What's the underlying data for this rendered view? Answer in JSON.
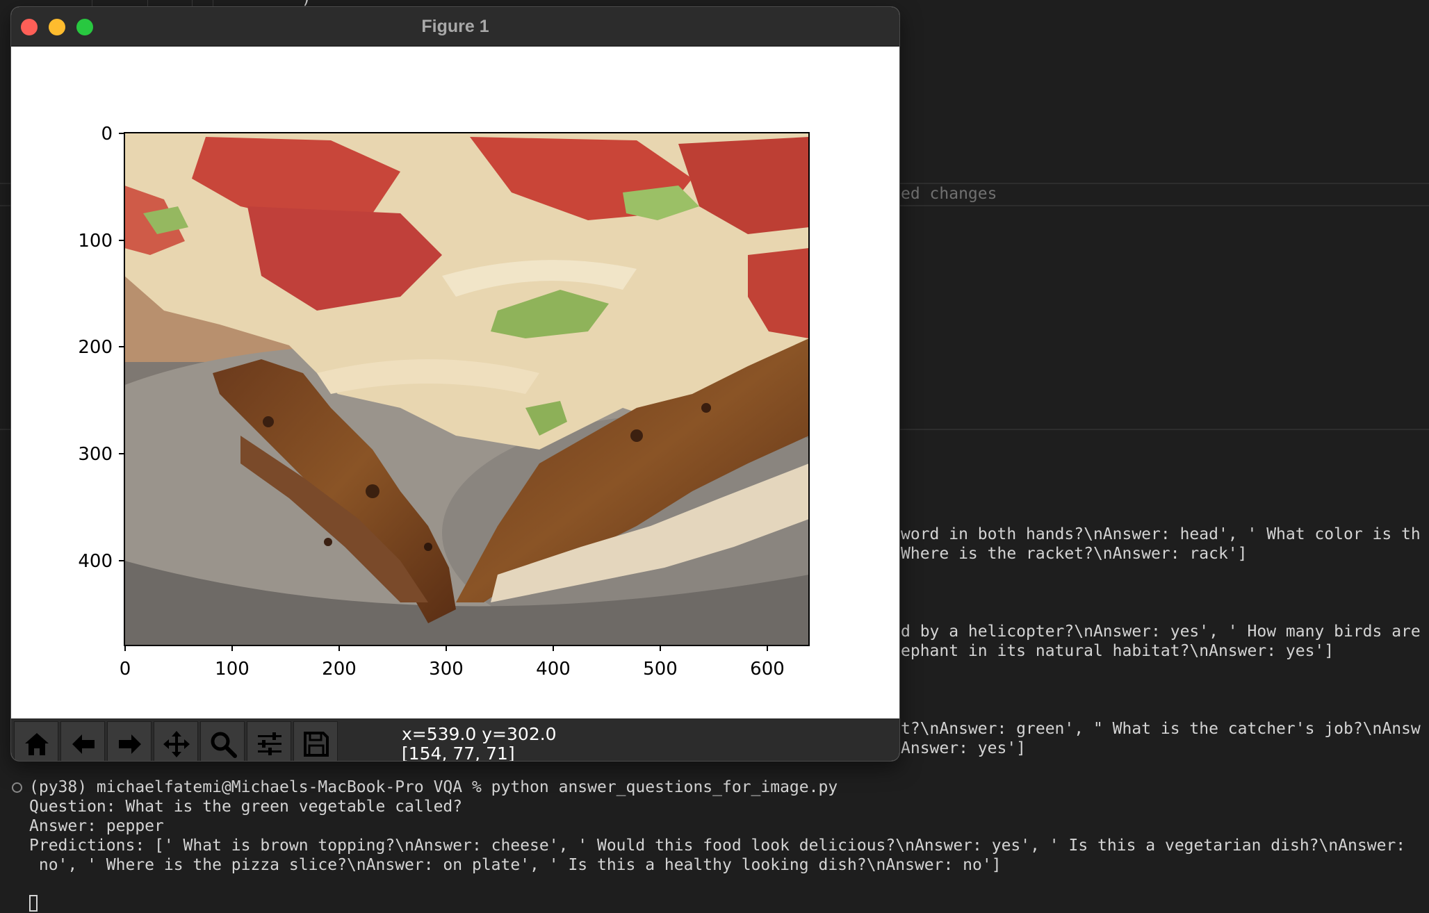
{
  "window": {
    "title": "Figure 1"
  },
  "plot": {
    "y_ticks": [
      "0",
      "100",
      "200",
      "300",
      "400"
    ],
    "x_ticks": [
      "0",
      "100",
      "200",
      "300",
      "400",
      "500",
      "600"
    ],
    "image_description_icon": "pizza-slice-photo"
  },
  "toolbar": {
    "buttons": [
      {
        "name": "home-icon"
      },
      {
        "name": "back-arrow-icon"
      },
      {
        "name": "forward-arrow-icon"
      },
      {
        "name": "pan-icon"
      },
      {
        "name": "zoom-icon"
      },
      {
        "name": "configure-subplots-icon"
      },
      {
        "name": "save-icon"
      }
    ],
    "coords_line1": "x=539.0 y=302.0",
    "coords_line2": "[154, 77, 71]"
  },
  "background": {
    "changes_fragment": "ed changes",
    "right_lines": [
      "word in both hands?\\nAnswer: head', ' What color is th",
      "Where is the racket?\\nAnswer: rack']",
      "d by a helicopter?\\nAnswer: yes', ' How many birds are",
      "ephant in its natural habitat?\\nAnswer: yes']",
      "t?\\nAnswer: green', \" What is the catcher's job?\\nAnsw",
      "Answer: yes']"
    ],
    "top_fragment": "')"
  },
  "terminal": {
    "prompt": "(py38) michaelfatemi@Michaels-MacBook-Pro VQA % python answer_questions_for_image.py",
    "question": "Question: What is the green vegetable called?",
    "answer": "Answer: pepper",
    "predictions_line1": "Predictions: [' What is brown topping?\\nAnswer: cheese', ' Would this food look delicious?\\nAnswer: yes', ' Is this a vegetarian dish?\\nAnswer:",
    "predictions_line2": " no', ' Where is the pizza slice?\\nAnswer: on plate', ' Is this a healthy looking dish?\\nAnswer: no']"
  }
}
